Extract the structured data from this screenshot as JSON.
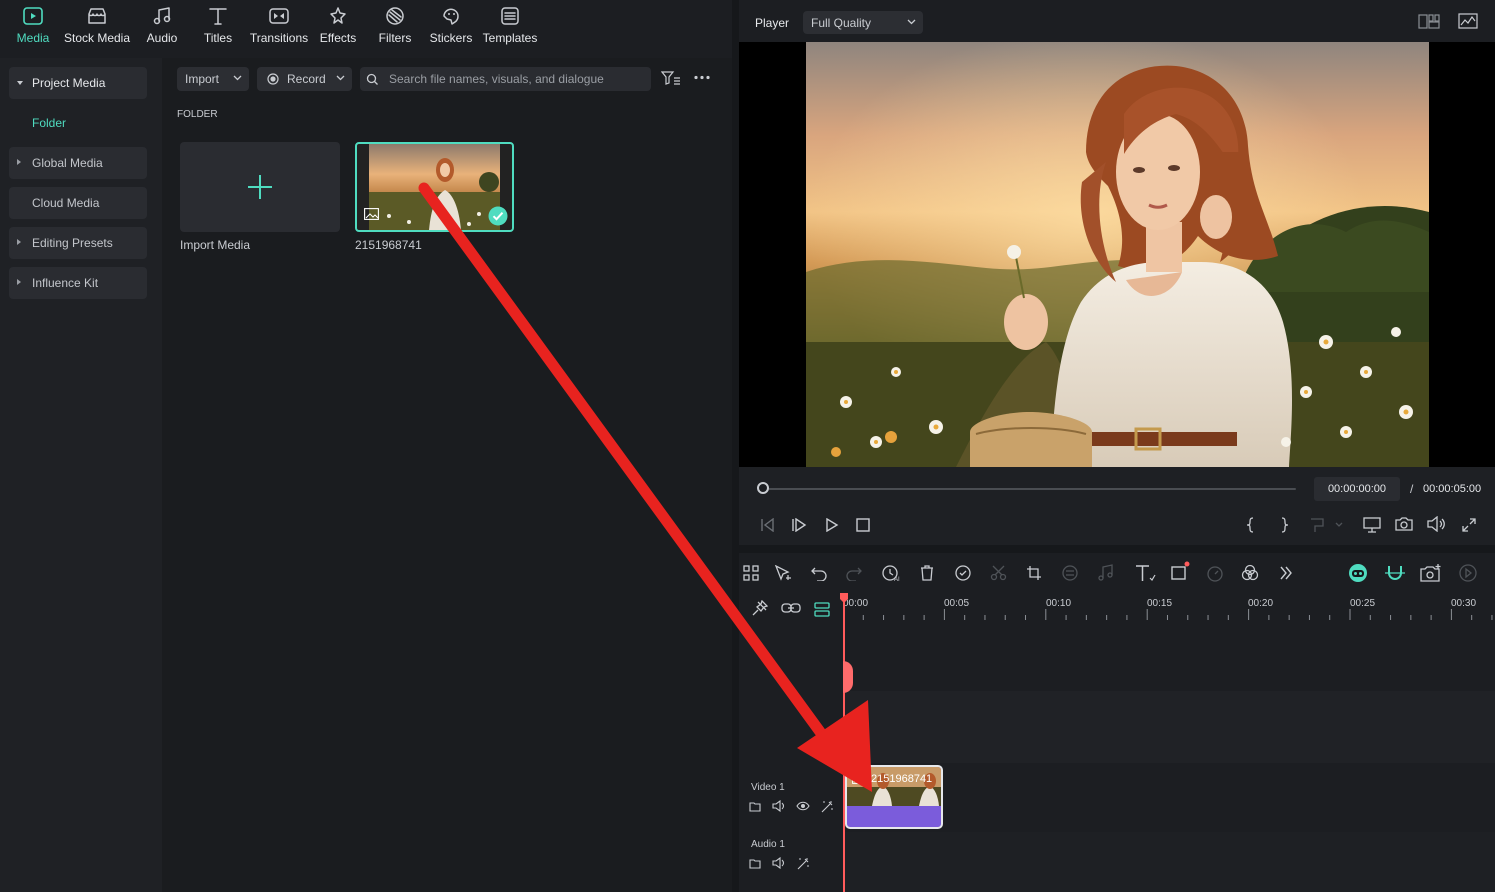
{
  "nav": {
    "items": [
      {
        "label": "Media",
        "icon": "media-icon",
        "active": true
      },
      {
        "label": "Stock Media",
        "icon": "stock-media-icon"
      },
      {
        "label": "Audio",
        "icon": "music-note-icon"
      },
      {
        "label": "Titles",
        "icon": "text-t-icon"
      },
      {
        "label": "Transitions",
        "icon": "transitions-icon"
      },
      {
        "label": "Effects",
        "icon": "effects-sparkle-icon"
      },
      {
        "label": "Filters",
        "icon": "filters-icon"
      },
      {
        "label": "Stickers",
        "icon": "stickers-icon"
      },
      {
        "label": "Templates",
        "icon": "templates-icon"
      }
    ],
    "accent_color": "#4fdcc0"
  },
  "sidebar": {
    "project_media": "Project Media",
    "folder": "Folder",
    "global_media": "Global Media",
    "cloud_media": "Cloud Media",
    "editing_presets": "Editing Presets",
    "influence_kit": "Influence Kit"
  },
  "media_toolbar": {
    "import_label": "Import",
    "record_label": "Record",
    "search_placeholder": "Search file names, visuals, and dialogue"
  },
  "media": {
    "folder_heading": "FOLDER",
    "import_tile_label": "Import Media",
    "clip_name": "2151968741"
  },
  "player": {
    "label": "Player",
    "quality": "Full Quality",
    "current_time": "00:00:00:00",
    "separator": "/",
    "total_time": "00:00:05:00",
    "progress": 0
  },
  "timeline": {
    "ruler": [
      "00:00",
      "00:05",
      "00:10",
      "00:15",
      "00:20",
      "00:25",
      "00:30"
    ],
    "tracks": {
      "video": "Video 1",
      "audio": "Audio 1"
    },
    "clip_label": "2151968741",
    "playhead_color": "#ff5b5b",
    "clip_color": "#7b5cdb"
  },
  "annotation": {
    "arrow_color": "#e8231f"
  }
}
